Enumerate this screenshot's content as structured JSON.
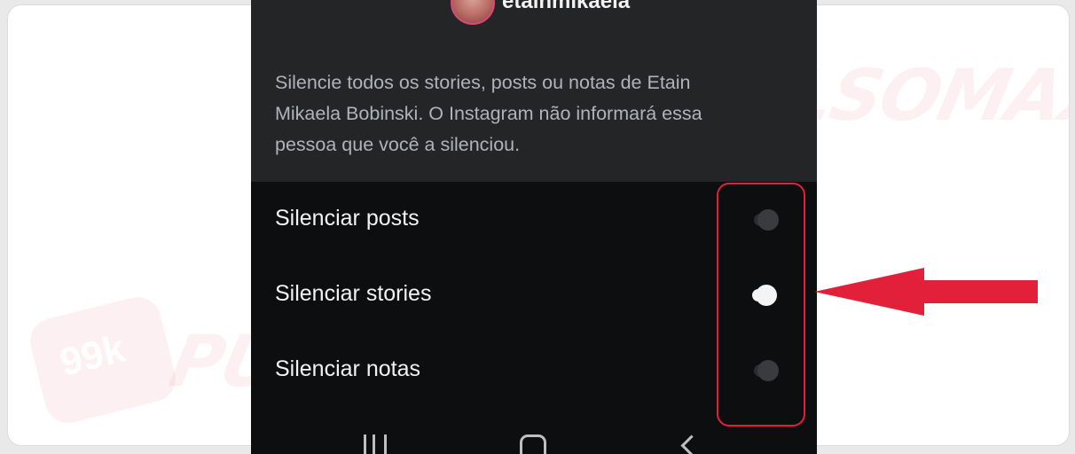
{
  "watermark": {
    "brand": "PULSOMAX",
    "badge": "99k"
  },
  "header": {
    "username": "etainmikaela"
  },
  "description": "Silencie todos os stories, posts ou notas de Etain Mikaela Bobinski. O Instagram não informará essa pessoa que você a silenciou.",
  "options": [
    {
      "label": "Silenciar posts",
      "enabled": false
    },
    {
      "label": "Silenciar stories",
      "enabled": true
    },
    {
      "label": "Silenciar notas",
      "enabled": false
    }
  ],
  "colors": {
    "highlight": "#e3203a",
    "arrow": "#e3203a",
    "toggle_on": "#f4f4f4",
    "toggle_off": "#3a3b3e"
  },
  "icons": {
    "nav_recent": "recent-apps-icon",
    "nav_home": "home-icon",
    "nav_back": "back-icon",
    "pointer": "arrow-left-icon"
  }
}
